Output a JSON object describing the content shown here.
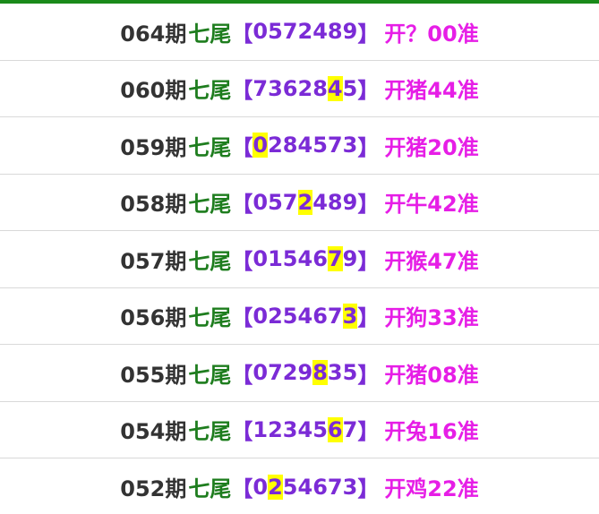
{
  "colors": {
    "top_border": "#1a8a1a",
    "period_text": "#333333",
    "label_text": "#1e7d1e",
    "digits_text": "#7b2bd6",
    "result_text": "#e61ee6",
    "highlight": "#ffff00"
  },
  "rows": [
    {
      "period": "064期",
      "label": "七尾",
      "open": "【",
      "digits": "0572489",
      "highlight": null,
      "close": "】",
      "result": "开？00准"
    },
    {
      "period": "060期",
      "label": "七尾",
      "open": "【",
      "digits": "7362845",
      "highlight": 5,
      "close": "】",
      "result": "开猪44准"
    },
    {
      "period": "059期",
      "label": "七尾",
      "open": "【",
      "digits": "0284573",
      "highlight": 0,
      "close": "】",
      "result": "开猪20准"
    },
    {
      "period": "058期",
      "label": "七尾",
      "open": "【",
      "digits": "0572489",
      "highlight": 3,
      "close": "】",
      "result": "开牛42准"
    },
    {
      "period": "057期",
      "label": "七尾",
      "open": "【",
      "digits": "0154679",
      "highlight": 5,
      "close": "】",
      "result": "开猴47准"
    },
    {
      "period": "056期",
      "label": "七尾",
      "open": "【",
      "digits": "0254673",
      "highlight": 6,
      "close": "】",
      "result": "开狗33准"
    },
    {
      "period": "055期",
      "label": "七尾",
      "open": "【",
      "digits": "0729835",
      "highlight": 4,
      "close": "】",
      "result": "开猪08准"
    },
    {
      "period": "054期",
      "label": "七尾",
      "open": "【",
      "digits": "1234567",
      "highlight": 5,
      "close": "】",
      "result": "开兔16准"
    },
    {
      "period": "052期",
      "label": "七尾",
      "open": "【",
      "digits": "0254673",
      "highlight": 1,
      "close": "】",
      "result": "开鸡22准"
    }
  ]
}
